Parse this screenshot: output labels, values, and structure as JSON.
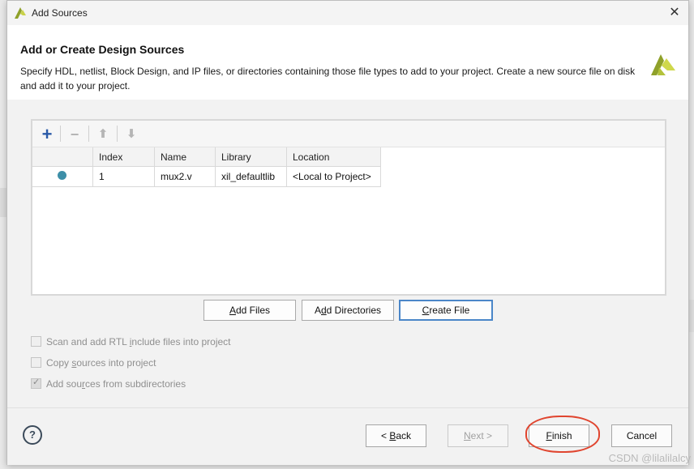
{
  "window": {
    "title": "Add Sources",
    "logo_icon": "vivado-logo-icon",
    "close_icon": "close-icon"
  },
  "header": {
    "heading": "Add or Create Design Sources",
    "description": "Specify HDL, netlist, Block Design, and IP files, or directories containing those file types to add to your project. Create a new source file on disk and add it to your project."
  },
  "toolbar": {
    "add": "+",
    "remove": "−",
    "move_up": "⬆",
    "move_down": "⬇"
  },
  "table": {
    "columns": [
      "",
      "Index",
      "Name",
      "Library",
      "Location"
    ],
    "rows": [
      {
        "status_color": "#3d8fa8",
        "index": "1",
        "name": "mux2.v",
        "library": "xil_defaultlib",
        "location": "<Local to Project>"
      }
    ]
  },
  "actions": {
    "add_files": {
      "u": "A",
      "rest": "dd Files"
    },
    "add_directories": {
      "pre": "A",
      "u": "d",
      "rest": "d Directories"
    },
    "create_file": {
      "u": "C",
      "rest": "reate File"
    }
  },
  "options": {
    "scan_rtl": {
      "pre": "Scan and add RTL ",
      "u": "i",
      "rest": "nclude files into project",
      "checked": false
    },
    "copy_sources": {
      "pre": "Copy ",
      "u": "s",
      "rest": "ources into project",
      "checked": false
    },
    "add_subdirs": {
      "pre": "Add sou",
      "u": "r",
      "rest": "ces from subdirectories",
      "checked": true
    }
  },
  "footer": {
    "help": "?",
    "back": {
      "pre": "< ",
      "u": "B",
      "rest": "ack"
    },
    "next": {
      "u": "N",
      "rest": "ext >"
    },
    "finish": {
      "u": "F",
      "rest": "inish"
    },
    "cancel": "Cancel"
  },
  "watermark": "CSDN @lilalilalcy",
  "colors": {
    "accent_focus": "#4a86c8",
    "annotation": "#e0452f",
    "status_dot": "#3d8fa8"
  }
}
